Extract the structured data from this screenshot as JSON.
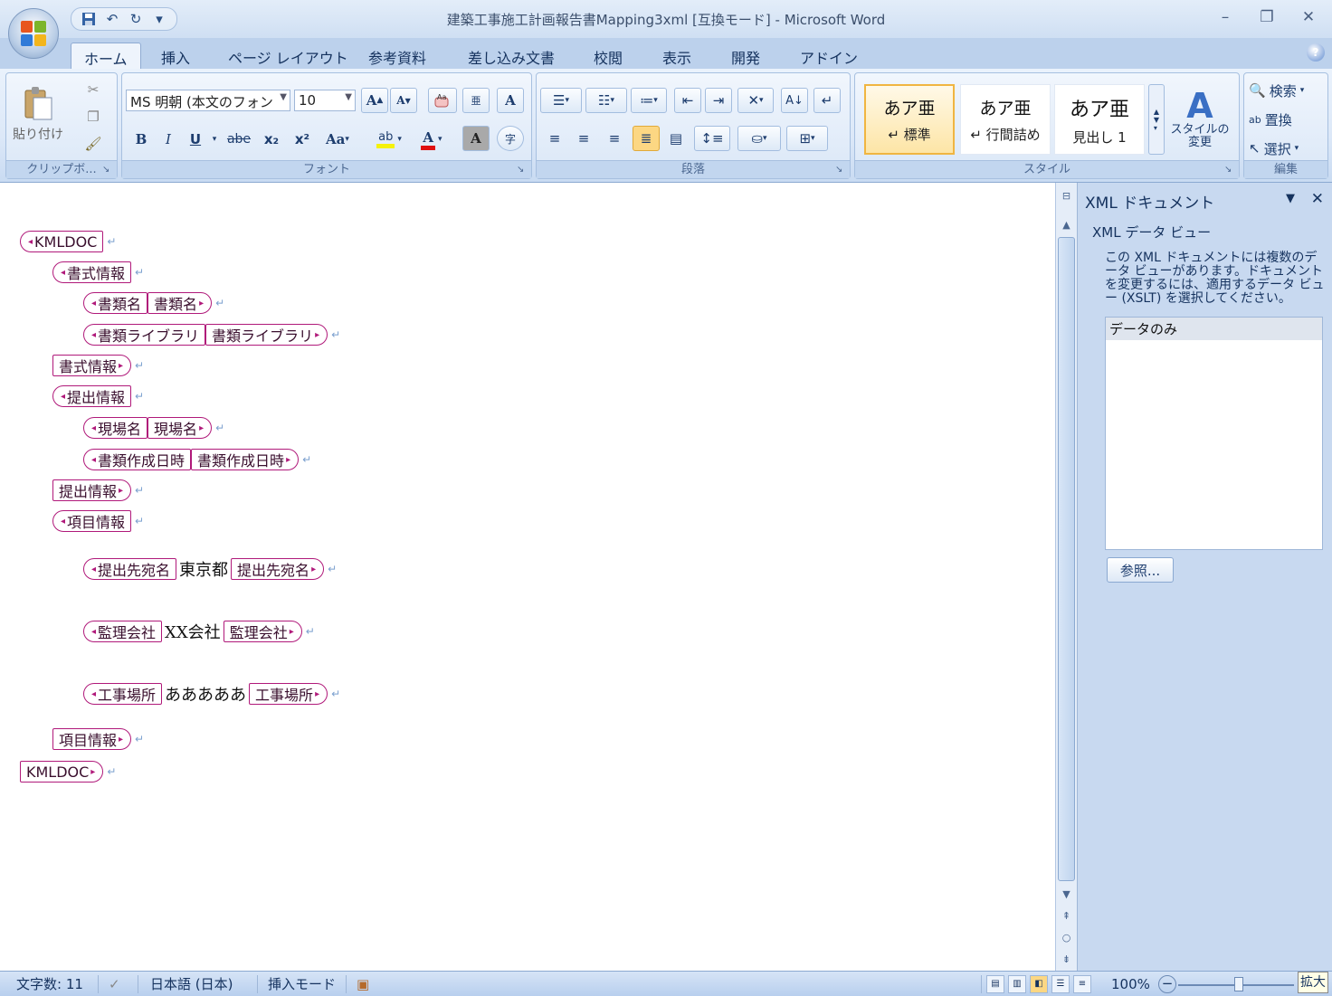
{
  "titlebar": {
    "title": "建築工事施工計画報告書Mapping3xml [互換モード] - Microsoft Word",
    "qat": [
      "save-icon",
      "undo-icon",
      "redo-icon",
      "customize-icon"
    ],
    "controls": {
      "minimize": "–",
      "restore": "❐",
      "close": "✕"
    }
  },
  "tabs": [
    "ホーム",
    "挿入",
    "ページ レイアウト",
    "参考資料",
    "差し込み文書",
    "校閲",
    "表示",
    "開発",
    "アドイン"
  ],
  "active_tab": "ホーム",
  "ribbon": {
    "clipboard": {
      "label": "クリップボ... ",
      "paste": "貼り付け"
    },
    "font": {
      "label": "フォント",
      "font_name": "MS 明朝 (本文のフォン",
      "font_size": "10",
      "bold": "B",
      "italic": "I",
      "underline": "U",
      "strike": "abe",
      "subscript": "x₂",
      "superscript": "x²",
      "case": "Aa",
      "grow": "A",
      "shrink": "A",
      "highlight": "ab",
      "font_color": "A",
      "char_shade": "A",
      "enclose": "字"
    },
    "paragraph": {
      "label": "段落"
    },
    "styles": {
      "label": "スタイル",
      "tiles": [
        {
          "sample": "あア亜",
          "name": "↵ 標準"
        },
        {
          "sample": "あア亜",
          "name": "↵ 行間詰め"
        },
        {
          "sample": "あア亜",
          "name": "見出し 1"
        }
      ],
      "change": "スタイルの 変更"
    },
    "editing": {
      "label": "編集",
      "find": "検索",
      "replace": "置換",
      "select": "選択"
    }
  },
  "document": {
    "lines": [
      {
        "indent": 0,
        "open": "KMLDOC",
        "content": "",
        "close": ""
      },
      {
        "indent": 1,
        "open": "書式情報",
        "content": "",
        "close": ""
      },
      {
        "indent": 2,
        "open": "書類名",
        "content": "",
        "close": "書類名"
      },
      {
        "indent": 2,
        "open": "書類ライブラリ",
        "content": "",
        "close": "書類ライブラリ"
      },
      {
        "indent": 1,
        "open": "",
        "content": "",
        "close": "書式情報"
      },
      {
        "indent": 1,
        "open": "提出情報",
        "content": "",
        "close": ""
      },
      {
        "indent": 2,
        "open": "現場名",
        "content": "",
        "close": "現場名"
      },
      {
        "indent": 2,
        "open": "書類作成日時",
        "content": "",
        "close": "書類作成日時"
      },
      {
        "indent": 1,
        "open": "",
        "content": "",
        "close": "提出情報"
      },
      {
        "indent": 1,
        "open": "項目情報",
        "content": "",
        "close": ""
      },
      {
        "indent": 2,
        "open": "提出先宛名",
        "content": "東京都",
        "close": "提出先宛名"
      },
      {
        "indent": 2,
        "open": "監理会社",
        "content": "XX会社",
        "close": "監理会社"
      },
      {
        "indent": 2,
        "open": "工事場所",
        "content": "あああああ",
        "close": "工事場所"
      },
      {
        "indent": 1,
        "open": "",
        "content": "",
        "close": "項目情報"
      },
      {
        "indent": 0,
        "open": "",
        "content": "",
        "close": "KMLDOC"
      }
    ]
  },
  "taskpane": {
    "title": "XML ドキュメント",
    "subtitle": "XML データ ビュー",
    "description": "この XML ドキュメントには複数のデータ ビューがあります。ドキュメントを変更するには、適用するデータ ビュー (XSLT) を選択してください。",
    "list_item": "データのみ",
    "browse": "参照..."
  },
  "statusbar": {
    "word_count": "文字数: 11",
    "language": "日本語 (日本)",
    "mode": "挿入モード",
    "zoom": "100%",
    "zoom_tooltip": "拡大"
  },
  "colors": {
    "tag_border": "#b0197a",
    "ribbon": "#dce8f8",
    "accent": "#15325e"
  }
}
